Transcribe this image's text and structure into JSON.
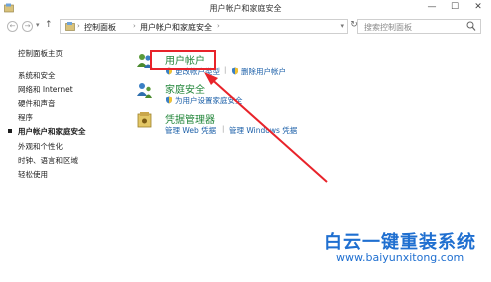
{
  "window": {
    "title": "用户帐户和家庭安全",
    "minimize": "—",
    "maximize": "☐",
    "close": "✕"
  },
  "nav": {
    "back": "←",
    "forward": "→",
    "up": "↑",
    "breadcrumbs": [
      "控制面板",
      "用户帐户和家庭安全"
    ],
    "separator": "›",
    "refresh": "↻",
    "search_placeholder": "搜索控制面板"
  },
  "sidebar": {
    "items": [
      {
        "label": "控制面板主页",
        "selected": false
      },
      {
        "label": "系统和安全",
        "selected": false
      },
      {
        "label": "网络和 Internet",
        "selected": false
      },
      {
        "label": "硬件和声音",
        "selected": false
      },
      {
        "label": "程序",
        "selected": false
      },
      {
        "label": "用户帐户和家庭安全",
        "selected": true
      },
      {
        "label": "外观和个性化",
        "selected": false
      },
      {
        "label": "时钟、语言和区域",
        "selected": false
      },
      {
        "label": "轻松使用",
        "selected": false
      }
    ]
  },
  "categories": [
    {
      "title": "用户帐户",
      "icon": "users-icon",
      "links": [
        "更改帐户类型",
        "删除用户帐户"
      ]
    },
    {
      "title": "家庭安全",
      "icon": "family-safety-icon",
      "links": [
        "为用户设置家庭安全"
      ]
    },
    {
      "title": "凭据管理器",
      "icon": "credential-manager-icon",
      "links": [
        "管理 Web 凭据",
        "管理 Windows 凭据"
      ]
    }
  ],
  "watermark": {
    "text": "白云一键重装系统",
    "url": "www.baiyunxitong.com"
  },
  "colors": {
    "accent_red": "#e8232a",
    "link_blue": "#1b5fa8",
    "category_green": "#22863a",
    "watermark_blue": "#1f6fd0"
  }
}
